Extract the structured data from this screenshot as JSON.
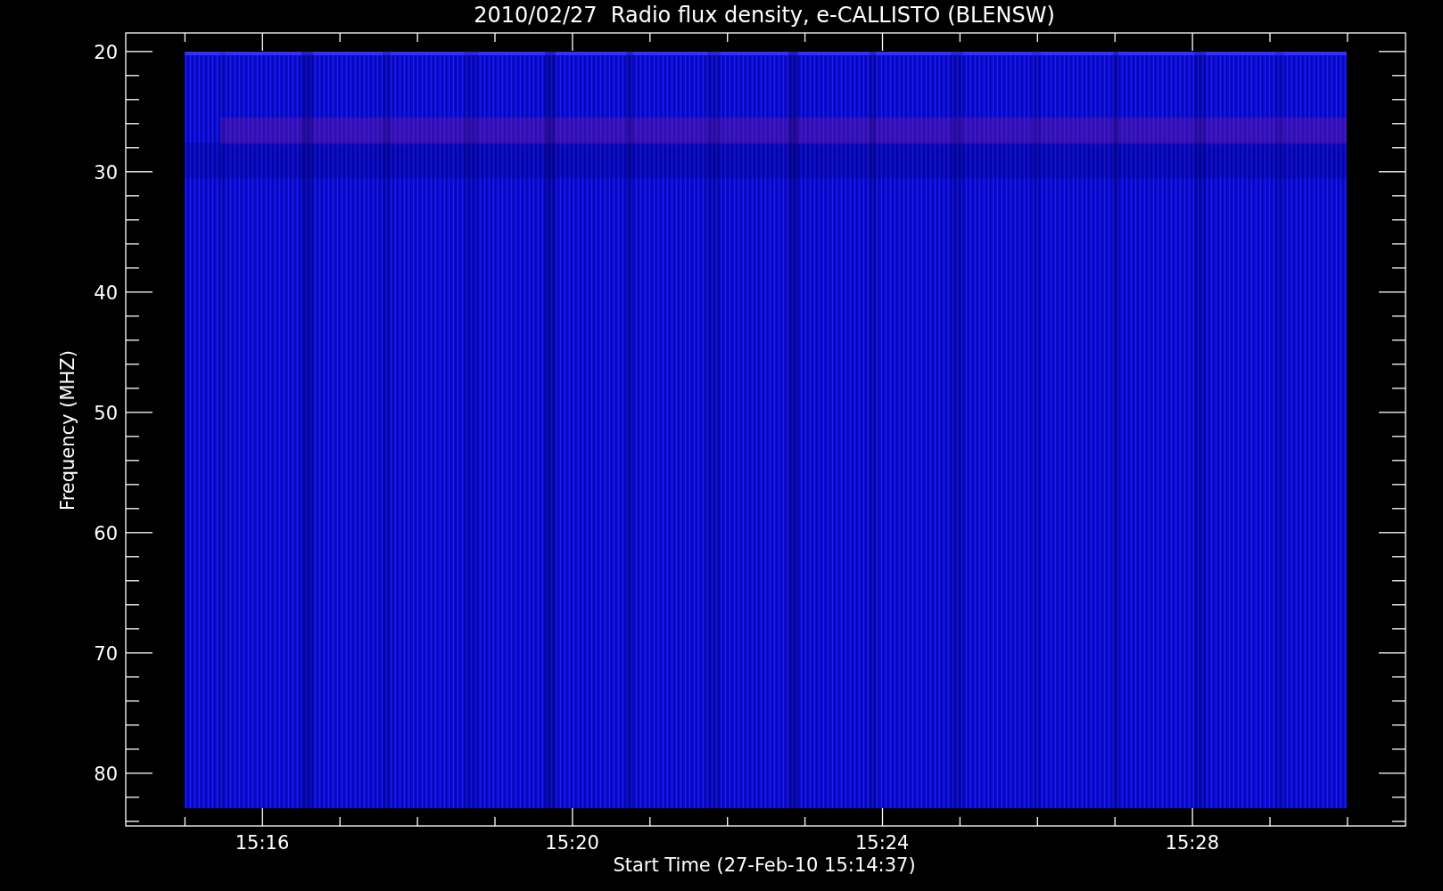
{
  "plot": {
    "title": "2010/02/27  Radio flux density, e-CALLISTO (BLENSW)",
    "y_axis": {
      "label": "Frequency (MHZ)",
      "ticks": [
        "20",
        "30",
        "40",
        "50",
        "60",
        "70",
        "80"
      ]
    },
    "x_axis": {
      "label": "Start Time (27-Feb-10 15:14:37)",
      "ticks": [
        "15:16",
        "15:20",
        "15:24",
        "15:28"
      ]
    }
  }
}
